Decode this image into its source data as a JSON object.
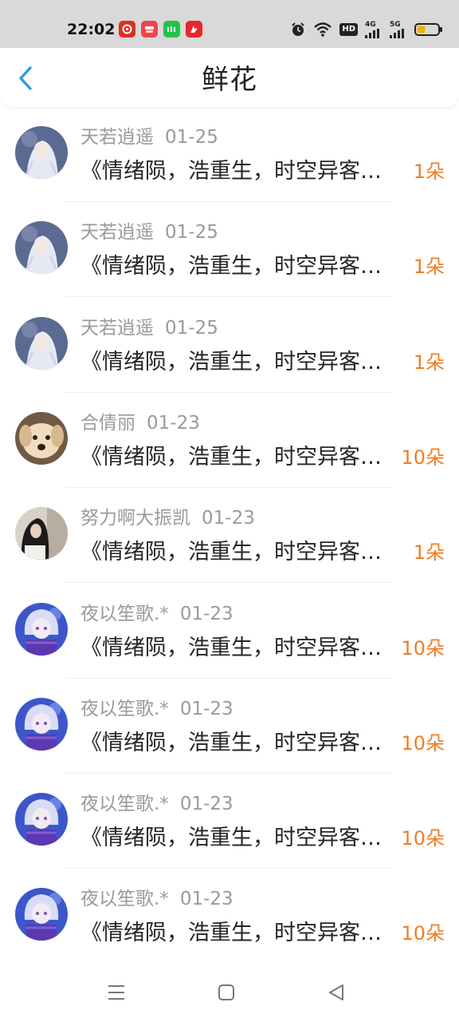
{
  "status_bar": {
    "time": "22:02",
    "apps": [
      {
        "icon": "app-pinduoduo-icon",
        "text": "",
        "color": "#e02e24"
      },
      {
        "icon": "app-taobao-deals-icon",
        "text": "",
        "color": "#f2434a"
      },
      {
        "icon": "app-iqiyi-icon",
        "text": "",
        "color": "#25c24a"
      },
      {
        "icon": "app-video-icon",
        "text": "",
        "color": "#e8262b"
      }
    ],
    "hd": "HD",
    "net_4g": "4G",
    "net_5g": "5G",
    "battery_level": 0.4
  },
  "header": {
    "title": "鲜花"
  },
  "colors": {
    "accent": "#2c9be6",
    "count": "#f07e25"
  },
  "items": [
    {
      "name": "天若逍遥",
      "date": "01-25",
      "message": "《情绪陨，浩重生，时空异客…",
      "count": "1朵",
      "avatar": "avatar-white-hair-girl"
    },
    {
      "name": "天若逍遥",
      "date": "01-25",
      "message": "《情绪陨，浩重生，时空异客…",
      "count": "1朵",
      "avatar": "avatar-white-hair-girl"
    },
    {
      "name": "天若逍遥",
      "date": "01-25",
      "message": "《情绪陨，浩重生，时空异客…",
      "count": "1朵",
      "avatar": "avatar-white-hair-girl"
    },
    {
      "name": "合倩丽",
      "date": "01-23",
      "message": "《情绪陨，浩重生，时空异客…",
      "count": "10朵",
      "avatar": "avatar-puppy"
    },
    {
      "name": "努力啊大振凯",
      "date": "01-23",
      "message": "《情绪陨，浩重生，时空异客…",
      "count": "1朵",
      "avatar": "avatar-dark-hair-girl"
    },
    {
      "name": "夜以笙歌.*",
      "date": "01-23",
      "message": "《情绪陨，浩重生，时空异客…",
      "count": "10朵",
      "avatar": "avatar-anime-boy"
    },
    {
      "name": "夜以笙歌.*",
      "date": "01-23",
      "message": "《情绪陨，浩重生，时空异客…",
      "count": "10朵",
      "avatar": "avatar-anime-boy"
    },
    {
      "name": "夜以笙歌.*",
      "date": "01-23",
      "message": "《情绪陨，浩重生，时空异客…",
      "count": "10朵",
      "avatar": "avatar-anime-boy"
    },
    {
      "name": "夜以笙歌.*",
      "date": "01-23",
      "message": "《情绪陨，浩重生，时空异客…",
      "count": "10朵",
      "avatar": "avatar-anime-boy"
    }
  ],
  "bottom_nav": [
    {
      "icon": "menu-icon"
    },
    {
      "icon": "home-square-icon"
    },
    {
      "icon": "back-triangle-icon"
    }
  ]
}
